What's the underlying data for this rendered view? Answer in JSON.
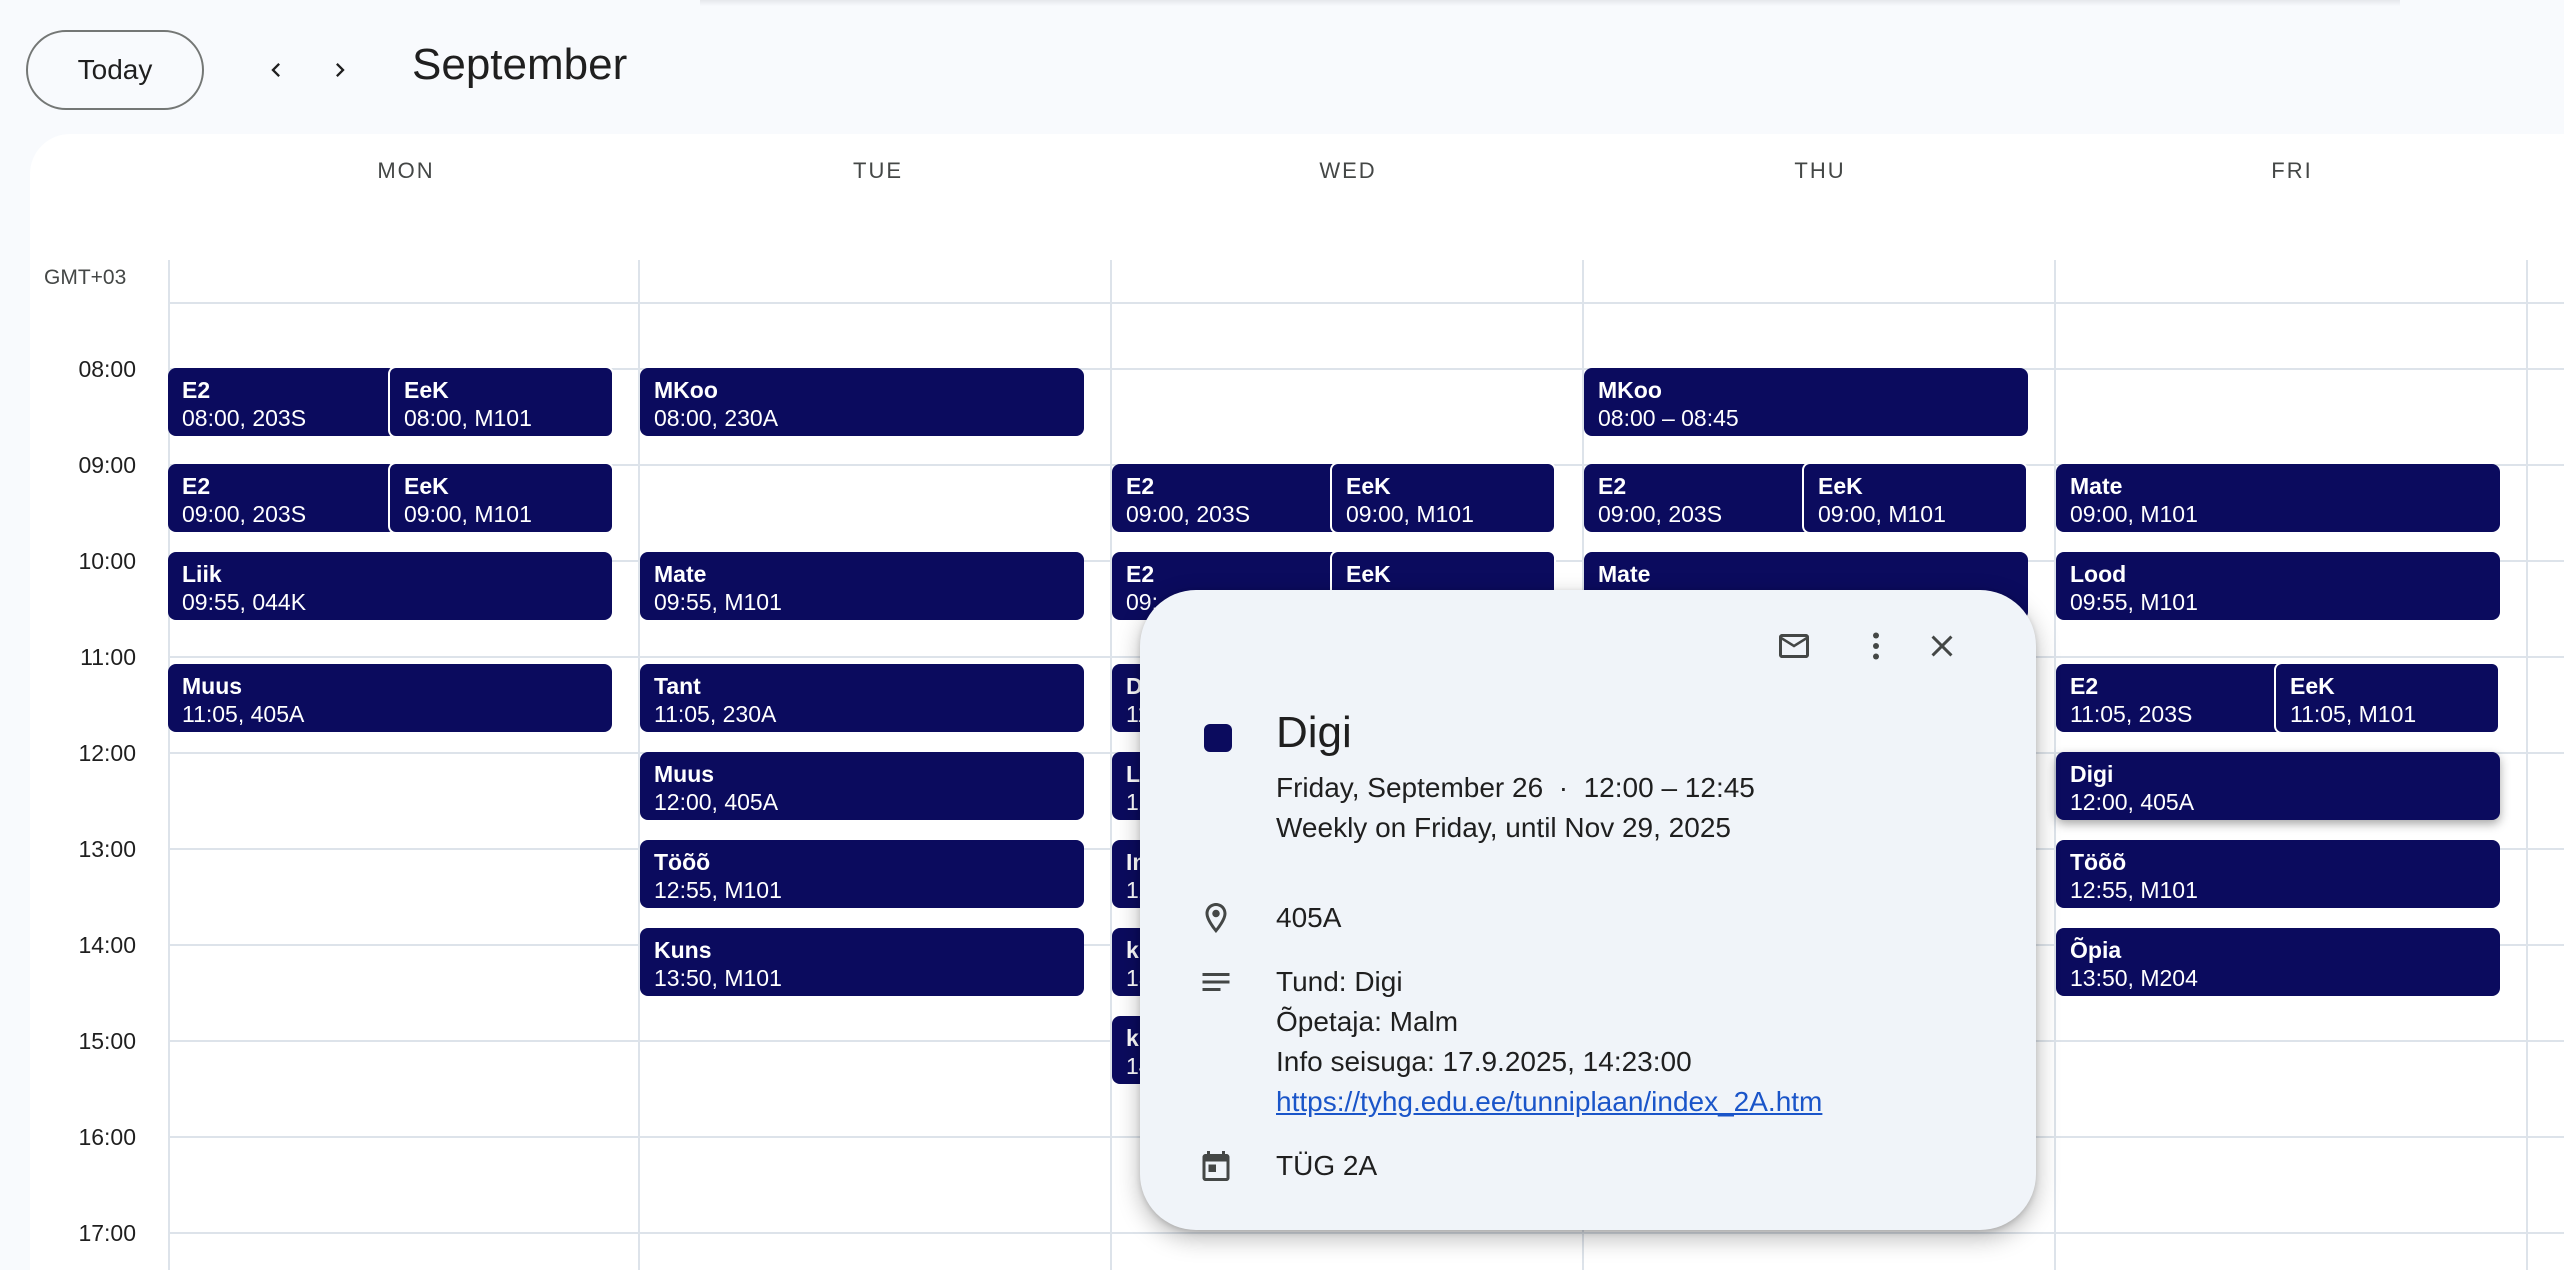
{
  "header": {
    "today_label": "Today",
    "prev_icon": "chevron-left-icon",
    "next_icon": "chevron-right-icon",
    "month": "September"
  },
  "calendar": {
    "timezone": "GMT+03",
    "days": [
      "MON",
      "TUE",
      "WED",
      "THU",
      "FRI"
    ],
    "hours": [
      "08:00",
      "09:00",
      "10:00",
      "11:00",
      "12:00",
      "13:00",
      "14:00",
      "15:00",
      "16:00",
      "17:00"
    ],
    "events": [
      {
        "title": "E2",
        "sub": "08:00, 203S"
      },
      {
        "title": "EeK",
        "sub": "08:00, M101"
      },
      {
        "title": "E2",
        "sub": "09:00, 203S"
      },
      {
        "title": "EeK",
        "sub": "09:00, M101"
      },
      {
        "title": "Liik",
        "sub": "09:55, 044K"
      },
      {
        "title": "Muus",
        "sub": "11:05, 405A"
      },
      {
        "title": "MKoo",
        "sub": "08:00, 230A"
      },
      {
        "title": "Mate",
        "sub": "09:55, M101"
      },
      {
        "title": "Tant",
        "sub": "11:05, 230A"
      },
      {
        "title": "Muus",
        "sub": "12:00, 405A"
      },
      {
        "title": "Töõõ",
        "sub": "12:55, M101"
      },
      {
        "title": "Kuns",
        "sub": "13:50, M101"
      },
      {
        "title": "E2",
        "sub": "09:00, 203S"
      },
      {
        "title": "EeK",
        "sub": "09:00, M101"
      },
      {
        "title": "E2",
        "sub": "09:"
      },
      {
        "title": "EeK",
        "sub": ""
      },
      {
        "title": "D",
        "sub": "11"
      },
      {
        "title": "L",
        "sub": "12"
      },
      {
        "title": "In",
        "sub": "12"
      },
      {
        "title": "k",
        "sub": "13"
      },
      {
        "title": "k",
        "sub": "14"
      },
      {
        "title": "MKoo",
        "sub": "08:00 – 08:45"
      },
      {
        "title": "E2",
        "sub": "09:00, 203S"
      },
      {
        "title": "EeK",
        "sub": "09:00, M101"
      },
      {
        "title": "Mate",
        "sub": ""
      },
      {
        "title": "Mate",
        "sub": "09:00, M101"
      },
      {
        "title": "Lood",
        "sub": "09:55, M101"
      },
      {
        "title": "E2",
        "sub": "11:05, 203S"
      },
      {
        "title": "EeK",
        "sub": "11:05, M101"
      },
      {
        "title": "Digi",
        "sub": "12:00, 405A"
      },
      {
        "title": "Töõõ",
        "sub": "12:55, M101"
      },
      {
        "title": "Õpia",
        "sub": "13:50, M204"
      }
    ]
  },
  "popup": {
    "mail_icon": "mail-icon",
    "more_icon": "more-vert-icon",
    "close_icon": "close-icon",
    "color": "#0b0b5e",
    "title": "Digi",
    "when": "Friday, September 26  ·  12:00 – 12:45",
    "recurrence": "Weekly on Friday, until Nov 29, 2025",
    "location": "405A",
    "description": {
      "line1": "Tund: Digi",
      "line2": "Õpetaja: Malm",
      "line3": "Info seisuga: 17.9.2025, 14:23:00",
      "link": "https://tyhg.edu.ee/tunniplaan/index_2A.htm"
    },
    "calendar_name": "TÜG 2A"
  }
}
